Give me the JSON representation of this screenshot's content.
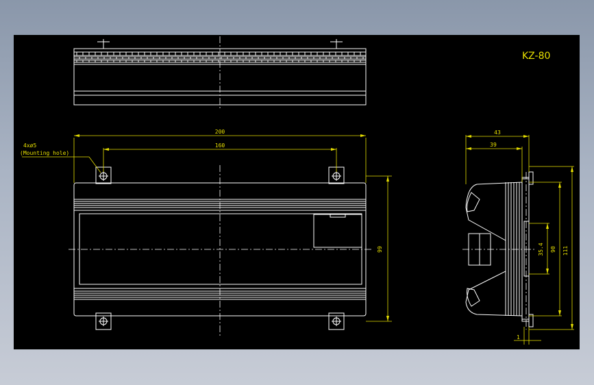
{
  "drawing": {
    "title": "KZ-80",
    "colors": {
      "background": "#000000",
      "lines": "#ffffff",
      "dimensions": "#e8e000"
    }
  },
  "dimensions": {
    "overall_width": "200",
    "hole_spacing": "160",
    "hole_note": "4xø5",
    "hole_note_sub": "(Mounting hole)",
    "front_height": "99",
    "side_depth": "43",
    "side_depth_inner": "39",
    "side_inner_height": "35.4",
    "side_rail_height": "90",
    "side_total_height": "111",
    "side_offset": "1"
  }
}
